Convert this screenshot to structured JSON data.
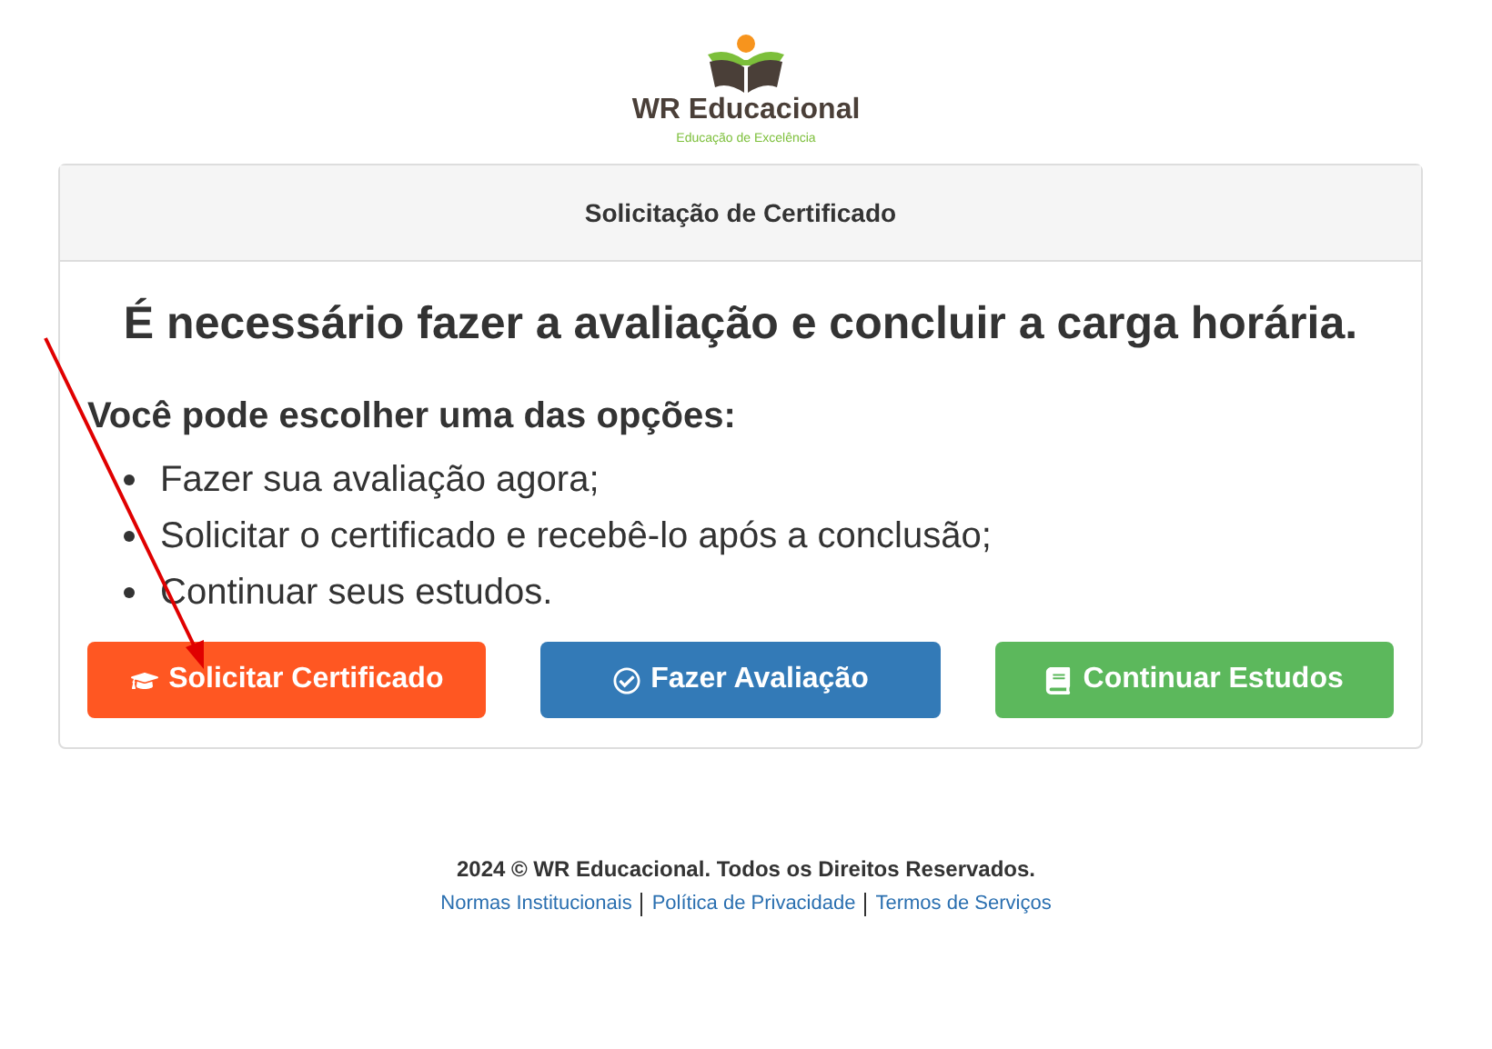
{
  "logo": {
    "name": "WR Educacional",
    "tagline": "Educação de Excelência"
  },
  "card": {
    "header": "Solicitação de Certificado",
    "heading": "É necessário fazer a avaliação e concluir a carga horária.",
    "subheading": "Você pode escolher uma das opções:",
    "options": [
      "Fazer sua avaliação agora;",
      "Solicitar o certificado e recebê-lo após a conclusão;",
      "Continuar seus estudos."
    ],
    "buttons": [
      {
        "label": "Solicitar Certificado",
        "kind": "certificate"
      },
      {
        "label": "Fazer Avaliação",
        "kind": "evaluation"
      },
      {
        "label": "Continuar Estudos",
        "kind": "study"
      }
    ]
  },
  "footer": {
    "copyright": "2024 © WR Educacional. Todos os Direitos Reservados.",
    "links": [
      "Normas Institucionais",
      "Política de Privacidade",
      "Termos de Serviços"
    ]
  }
}
